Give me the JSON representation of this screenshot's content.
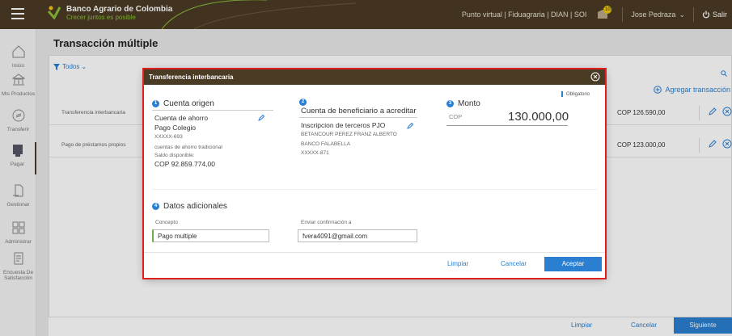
{
  "header": {
    "brand": "Banco Agrario de Colombia",
    "slogan": "Crecer juntos es posible",
    "links": "Punto virtual | Fiduagraria | DIAN | SOI",
    "notif_count": "10",
    "user": "Jose Pedraza",
    "logout": "Salir",
    "brand_color": "#4a3b24",
    "accent_color": "#2a7fd0"
  },
  "sidebar": {
    "items": [
      {
        "label": "Inicio",
        "icon": "home-icon"
      },
      {
        "label": "Mis Productos",
        "icon": "bank-icon"
      },
      {
        "label": "Transferir",
        "icon": "transfer-icon"
      },
      {
        "label": "Pagar",
        "icon": "pay-icon"
      },
      {
        "label": "Gestionar",
        "icon": "manage-icon"
      },
      {
        "label": "Administrar",
        "icon": "grid-icon"
      },
      {
        "label": "Encuesta De Satisfacción",
        "icon": "survey-icon"
      }
    ]
  },
  "page": {
    "title": "Transacción múltiple",
    "filter": "Todos",
    "add_transaction": "Agregar transacción",
    "rows": [
      {
        "label": "Transferencia interbancaria",
        "amount": "COP 126.590,00"
      },
      {
        "label": "Pago de préstamos propios",
        "amount": "COP 123.000,00"
      }
    ],
    "footer": {
      "limpiar": "Limpiar",
      "cancelar": "Cancelar",
      "siguiente": "Siguiente"
    }
  },
  "modal": {
    "title": "Transferencia interbancaria",
    "obligatorio": "Obligatorio",
    "origen": {
      "num": "1",
      "title": "Cuenta origen",
      "account_type": "Cuenta de ahorro",
      "account_name": "Pago Colegio",
      "account_number": "XXXXX-693",
      "account_desc": "cuentas de ahorro tradicional",
      "saldo_label": "Saldo disponible:",
      "saldo_value": "COP 92.859.774,00"
    },
    "beneficiario": {
      "num": "2",
      "title": "Cuenta de beneficiario a acreditar",
      "inscripcion": "Inscripcion de terceros PJO",
      "name": "BETANCOUR PEREZ FRANZ ALBERTO",
      "bank": "BANCO FALABELLA",
      "account_number": "XXXXX-871"
    },
    "monto": {
      "num": "3",
      "title": "Monto",
      "currency": "COP",
      "value": "130.000,00"
    },
    "adicionales": {
      "num": "4",
      "title": "Datos adicionales",
      "concepto_label": "Concepto",
      "concepto_value": "Pago multiple",
      "email_label": "Enviar confirmación a",
      "email_value": "fvera4091@gmail.com"
    },
    "buttons": {
      "limpiar": "Limpiar",
      "cancelar": "Cancelar",
      "aceptar": "Aceptar"
    }
  }
}
